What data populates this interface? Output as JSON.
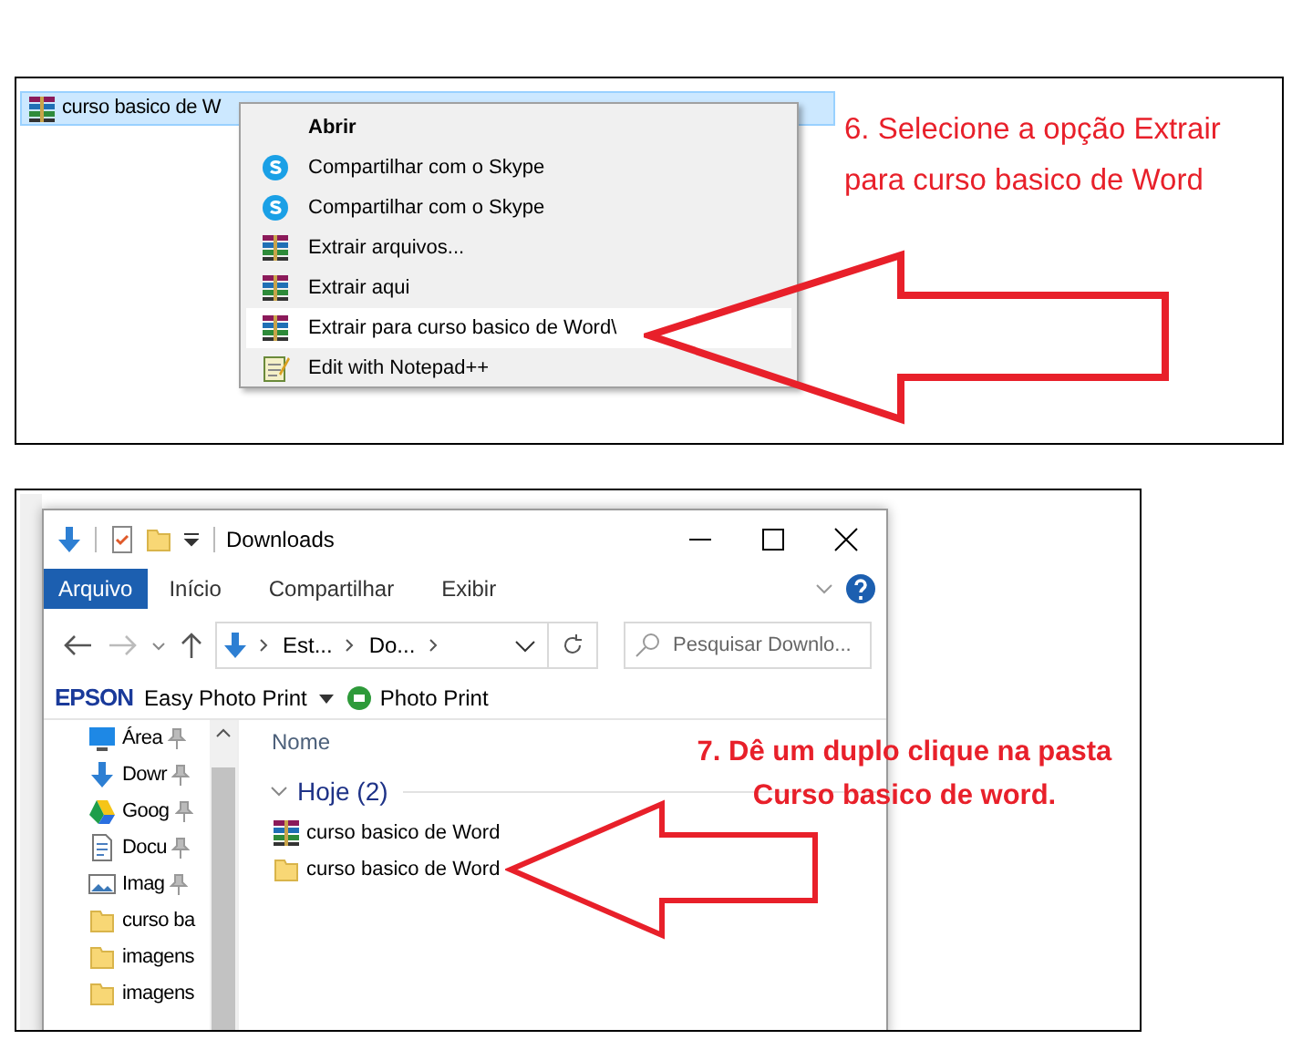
{
  "step6": {
    "file": {
      "name": "curso basico de W",
      "selected": true
    },
    "menu": [
      {
        "label": "Abrir",
        "kind": "default",
        "selected": false
      },
      {
        "label": "Compartilhar com o Skype",
        "kind": "skype",
        "selected": false
      },
      {
        "label": "Compartilhar com o Skype",
        "kind": "skype",
        "selected": false
      },
      {
        "label": "Extrair arquivos...",
        "kind": "archive",
        "selected": false
      },
      {
        "label": "Extrair aqui",
        "kind": "archive",
        "selected": false
      },
      {
        "label": "Extrair para curso basico de Word\\",
        "kind": "archive",
        "selected": true
      },
      {
        "label": "Edit with Notepad++",
        "kind": "notepad",
        "selected": false
      }
    ],
    "caption": [
      "6. Selecione a opção Extrair",
      "para curso basico de Word"
    ]
  },
  "step7": {
    "window": {
      "title": "Downloads"
    },
    "ribbon_tabs": [
      {
        "label": "Arquivo",
        "selected": true
      },
      {
        "label": "Início",
        "selected": false
      },
      {
        "label": "Compartilhar",
        "selected": false
      },
      {
        "label": "Exibir",
        "selected": false
      }
    ],
    "address": {
      "crumbs": [
        "Est...",
        "Do..."
      ]
    },
    "search": {
      "placeholder": "Pesquisar Downlo..."
    },
    "toolbar": {
      "brand": "EPSON",
      "items": [
        {
          "label": "Easy Photo Print",
          "kind": "dropdown"
        },
        {
          "label": "Photo Print",
          "kind": "button"
        }
      ]
    },
    "nav": [
      {
        "label": "Área",
        "kind": "desktop",
        "pinned": true
      },
      {
        "label": "Dowr",
        "kind": "download",
        "pinned": true
      },
      {
        "label": "Goog",
        "kind": "drive",
        "pinned": true
      },
      {
        "label": "Docu",
        "kind": "document",
        "pinned": true
      },
      {
        "label": "Imag",
        "kind": "image",
        "pinned": true
      },
      {
        "label": "curso ba",
        "kind": "folder",
        "pinned": false
      },
      {
        "label": "imagens",
        "kind": "folder",
        "pinned": false
      },
      {
        "label": "imagens",
        "kind": "folder",
        "pinned": false
      }
    ],
    "column": "Nome",
    "group": {
      "label": "Hoje (2)",
      "expanded": true
    },
    "files": [
      {
        "name": "curso basico de Word",
        "kind": "archive"
      },
      {
        "name": "curso basico de Word",
        "kind": "folder"
      }
    ],
    "caption": [
      "7. Dê um duplo clique na pasta",
      "Curso basico de word."
    ]
  }
}
